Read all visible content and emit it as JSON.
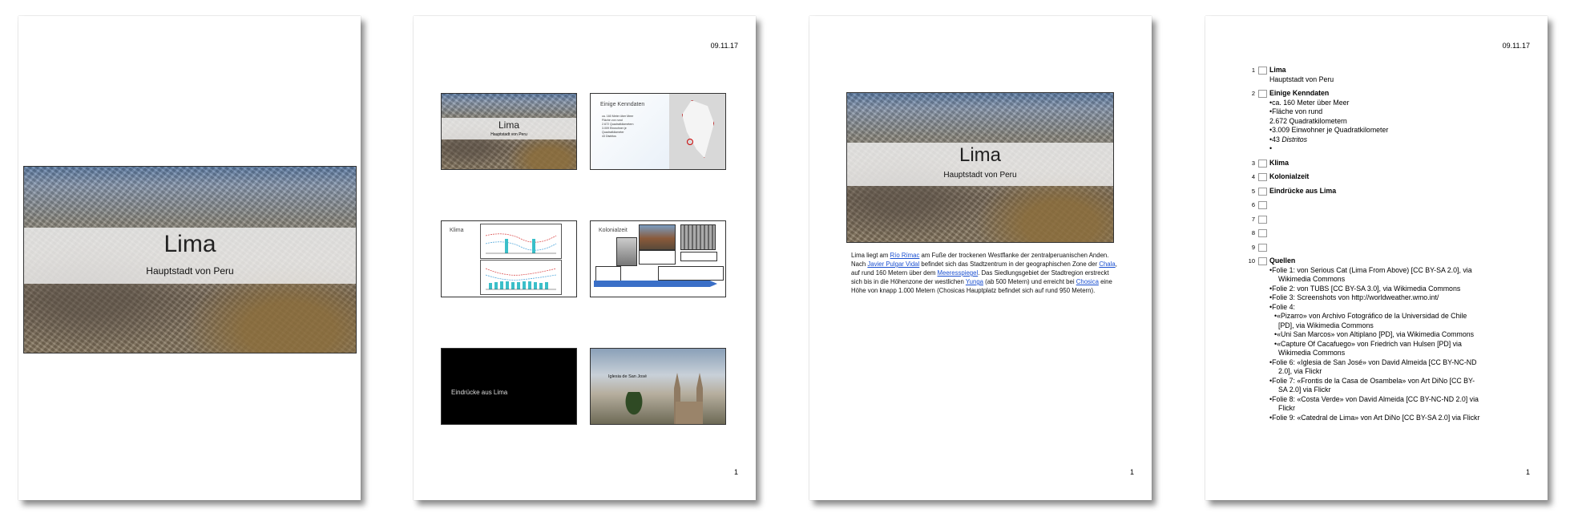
{
  "document": {
    "date": "09.11.17",
    "page_number": "1"
  },
  "slide_title": {
    "title": "Lima",
    "subtitle": "Hauptstadt von Peru"
  },
  "thumbnails": {
    "t2_title": "Einige Kenndaten",
    "t2_items": [
      "ca. 160 Meter über Meer",
      "Fläche von rund",
      "2.672 Quadratkilometern",
      "3.009 Einwohner je",
      "Quadratkilometer",
      "43 Distritos"
    ],
    "t3_title": "Klima",
    "t4_title": "Kolonialzeit",
    "t5_title": "Eindrücke aus Lima",
    "t6_title": "Iglesia de San José"
  },
  "notes": {
    "p1": "Lima liegt am ",
    "link_rimac": "Río Rímac",
    "p2": " am Fuße der trockenen Westflanke der zentralperuanischen Anden. Nach ",
    "link_pulgar": "Javier Pulgar Vidal",
    "p3": " befindet sich das Stadtzentrum in der geographischen Zone der ",
    "link_chala": "Chala",
    "p4": ", auf rund 160 Metern über dem ",
    "link_meer": "Meeresspiegel",
    "p5": ". Das Siedlungsgebiet der Stadtregion erstreckt sich bis in die Höhenzone der westlichen ",
    "link_yunga": "Yunga",
    "p6": " (ab 500 Metern) und erreicht bei ",
    "link_chosica": "Chosica",
    "p7": " eine Höhe von knapp 1.000 Metern (Chosicas Hauptplatz befindet sich auf rund 950 Metern)."
  },
  "outline": {
    "items": [
      {
        "num": "1",
        "title": "Lima"
      },
      {
        "num": "2",
        "title": "Einige Kenndaten"
      },
      {
        "num": "3",
        "title": "Klima"
      },
      {
        "num": "4",
        "title": "Kolonialzeit"
      },
      {
        "num": "5",
        "title": "Eindrücke aus Lima"
      },
      {
        "num": "6",
        "title": ""
      },
      {
        "num": "7",
        "title": ""
      },
      {
        "num": "8",
        "title": ""
      },
      {
        "num": "9",
        "title": ""
      },
      {
        "num": "10",
        "title": "Quellen"
      }
    ],
    "s1_sub": "Hauptstadt von Peru",
    "s2_b1": "•ca. 160 Meter über Meer",
    "s2_b2": "•Fläche von rund",
    "s2_b2b": "2.672 Quadratkilometern",
    "s2_b3": "•3.009 Einwohner je Quadratkilometer",
    "s2_b4a": "•43 ",
    "s2_b4b": "Distritos",
    "s2_b5": "•",
    "src": [
      "•Folie 1: von Serious Cat (Lima From Above) [CC BY-SA 2.0], via",
      "Wikimedia Commons",
      "•Folie 2: von TUBS [CC BY-SA 3.0], via Wikimedia Commons",
      "•Folie 3: Screenshots von http://worldweather.wmo.int/",
      "•Folie 4:",
      "•«Pizarro» von Archivo Fotográfico de la Universidad de Chile",
      "[PD], via Wikimedia Commons",
      "•«Uni San Marcos» von Altiplano [PD], via Wikimedia Commons",
      "•«Capture Of Cacafuego» von Friedrich van Hulsen [PD] via",
      "Wikimedia Commons",
      "•Folie 6: «Iglesia de San José» von David Almeida [CC BY-NC-ND",
      "2.0], via Flickr",
      "•Folie 7: «Frontis de la Casa de Osambela» von Art DiNo [CC BY-",
      "SA 2.0] via Flickr",
      "•Folie 8: «Costa Verde» von David Almeida [CC BY-NC-ND 2.0] via",
      "Flickr",
      "•Folie 9: «Catedral de Lima» von Art DiNo [CC BY-SA 2.0] via Flickr"
    ]
  }
}
